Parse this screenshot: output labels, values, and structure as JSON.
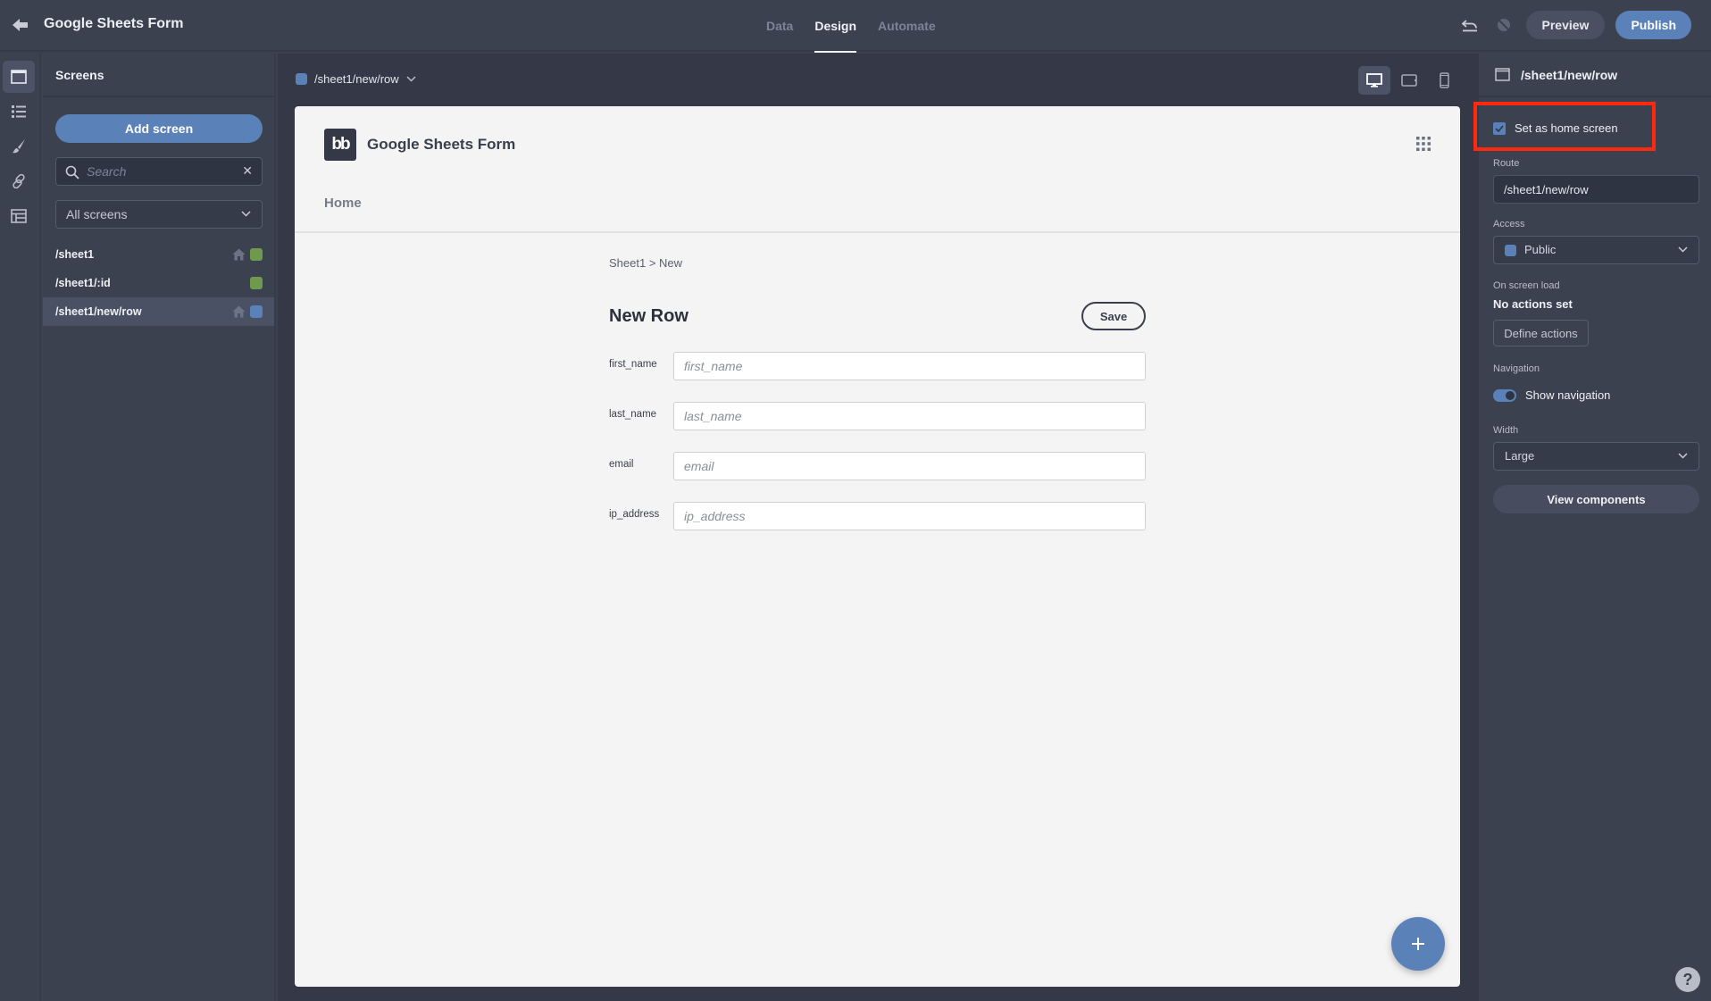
{
  "header": {
    "app_title": "Google Sheets Form",
    "tabs": [
      {
        "label": "Data",
        "active": false
      },
      {
        "label": "Design",
        "active": true
      },
      {
        "label": "Automate",
        "active": false
      }
    ],
    "preview_label": "Preview",
    "publish_label": "Publish"
  },
  "rail": {
    "items": [
      "screens",
      "components",
      "theme",
      "links",
      "data"
    ]
  },
  "sidebar": {
    "title": "Screens",
    "add_screen_label": "Add screen",
    "search_placeholder": "Search",
    "filter_value": "All screens",
    "screens": [
      {
        "route": "/sheet1",
        "is_home": true,
        "access_color": "#6e9a4d",
        "selected": false
      },
      {
        "route": "/sheet1/:id",
        "is_home": false,
        "access_color": "#6e9a4d",
        "selected": false
      },
      {
        "route": "/sheet1/new/row",
        "is_home": true,
        "access_color": "#5b82b8",
        "selected": true
      }
    ]
  },
  "canvas_toolbar": {
    "current_route": "/sheet1/new/row",
    "devices": [
      "desktop",
      "tablet",
      "mobile"
    ],
    "active_device": "desktop"
  },
  "preview": {
    "logo_text": "bb",
    "app_name": "Google Sheets Form",
    "nav_links": [
      "Home"
    ],
    "breadcrumb": {
      "parent": "Sheet1",
      "separator": ">",
      "current": "New"
    },
    "page_title": "New Row",
    "save_label": "Save",
    "fields": [
      {
        "label": "first_name",
        "placeholder": "first_name",
        "value": ""
      },
      {
        "label": "last_name",
        "placeholder": "last_name",
        "value": ""
      },
      {
        "label": "email",
        "placeholder": "email",
        "value": ""
      },
      {
        "label": "ip_address",
        "placeholder": "ip_address",
        "value": ""
      }
    ]
  },
  "settings": {
    "screen_route": "/sheet1/new/row",
    "home_screen_label": "Set as home screen",
    "home_screen_checked": true,
    "route_label": "Route",
    "route_value": "/sheet1/new/row",
    "access_label": "Access",
    "access_value": "Public",
    "on_load_label": "On screen load",
    "on_load_status": "No actions set",
    "define_actions_label": "Define actions",
    "navigation_label": "Navigation",
    "show_navigation_label": "Show navigation",
    "show_navigation_on": true,
    "width_label": "Width",
    "width_value": "Large",
    "view_components_label": "View components",
    "help_label": "?"
  },
  "colors": {
    "accent": "#5b82b8",
    "highlight": "#ff2a0d",
    "access_public": "#5b82b8",
    "access_green": "#6e9a4d"
  }
}
